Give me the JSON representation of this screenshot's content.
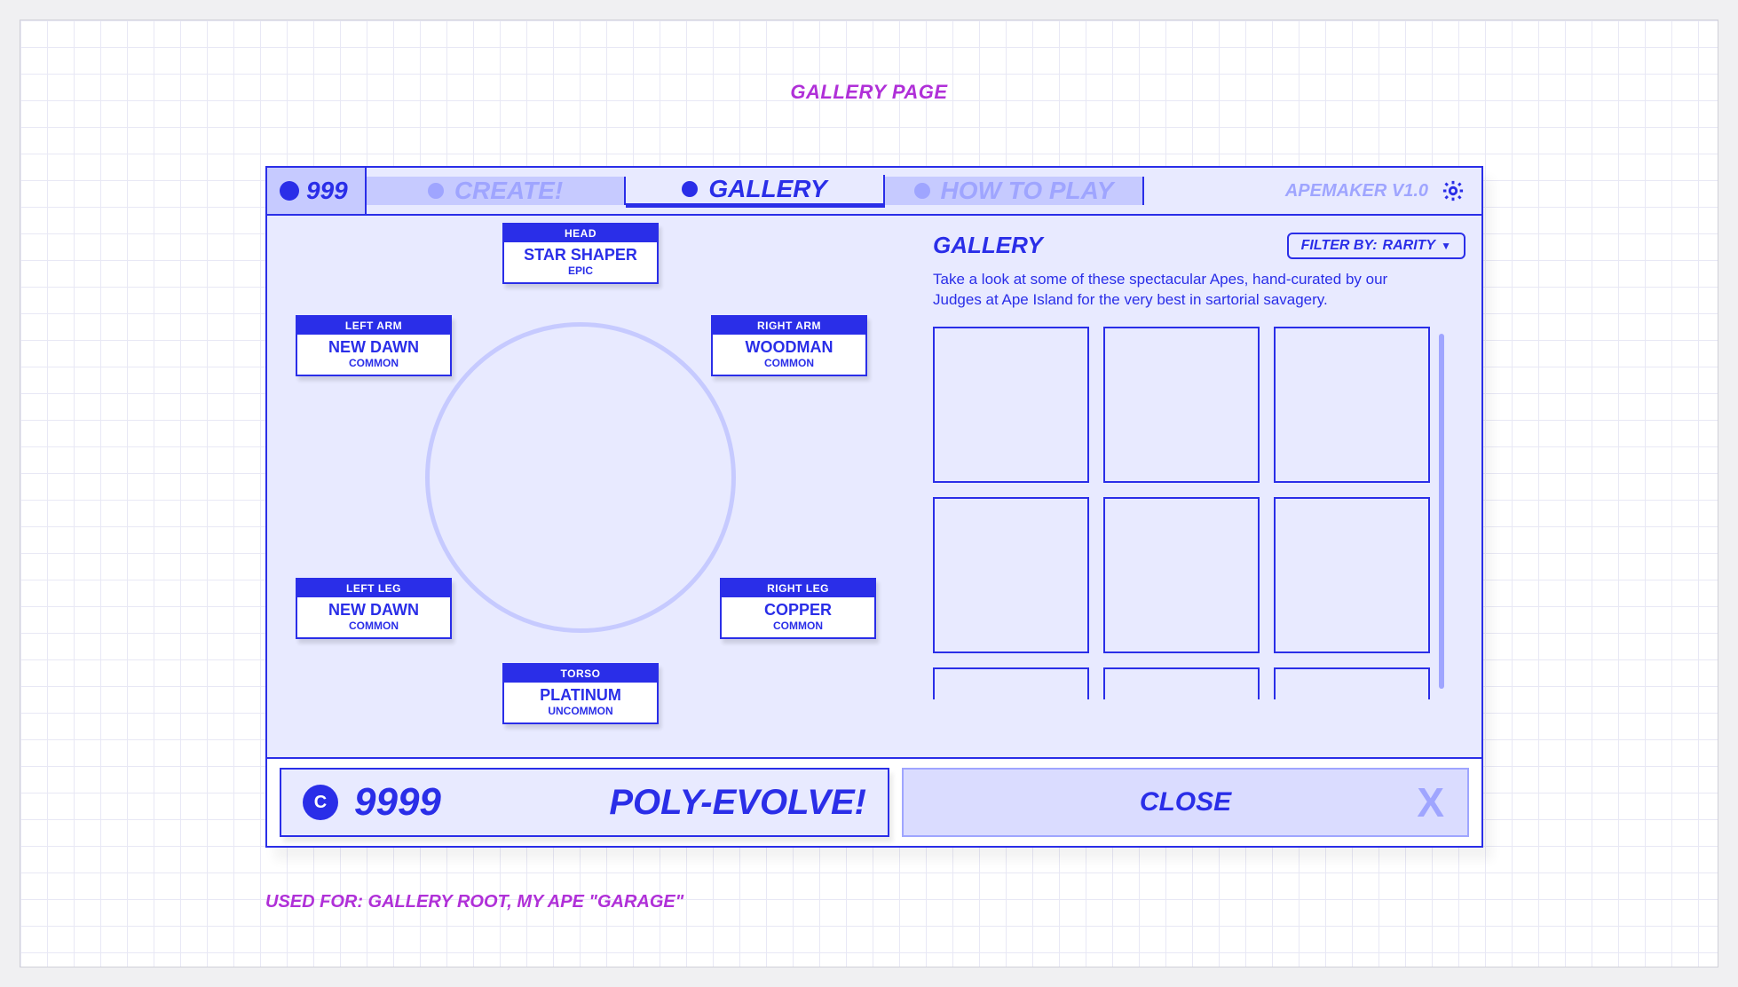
{
  "page_title": "GALLERY PAGE",
  "footnote": "USED FOR: GALLERY ROOT, MY APE \"GARAGE\"",
  "topbar": {
    "coins": "999",
    "tabs": [
      {
        "label": "CREATE!",
        "active": false
      },
      {
        "label": "GALLERY",
        "active": true
      },
      {
        "label": "HOW TO PLAY",
        "active": false
      }
    ],
    "version": "APEMAKER V1.0"
  },
  "parts": {
    "head": {
      "slot": "HEAD",
      "name": "STAR SHAPER",
      "rarity": "EPIC"
    },
    "left_arm": {
      "slot": "LEFT ARM",
      "name": "NEW DAWN",
      "rarity": "COMMON"
    },
    "right_arm": {
      "slot": "RIGHT ARM",
      "name": "WOODMAN",
      "rarity": "COMMON"
    },
    "left_leg": {
      "slot": "LEFT LEG",
      "name": "NEW DAWN",
      "rarity": "COMMON"
    },
    "right_leg": {
      "slot": "RIGHT LEG",
      "name": "COPPER",
      "rarity": "COMMON"
    },
    "torso": {
      "slot": "TORSO",
      "name": "PLATINUM",
      "rarity": "UNCOMMON"
    }
  },
  "gallery": {
    "title": "GALLERY",
    "description": "Take a look at some of these spectacular Apes, hand-curated by our Judges at Ape Island for the very best in sartorial savagery.",
    "filter_label": "FILTER BY:",
    "filter_value": "RARITY"
  },
  "bottom": {
    "evolve_cost": "9999",
    "evolve_label": "POLY-EVOLVE!",
    "close_label": "CLOSE",
    "close_x": "X",
    "currency_glyph": "C"
  }
}
